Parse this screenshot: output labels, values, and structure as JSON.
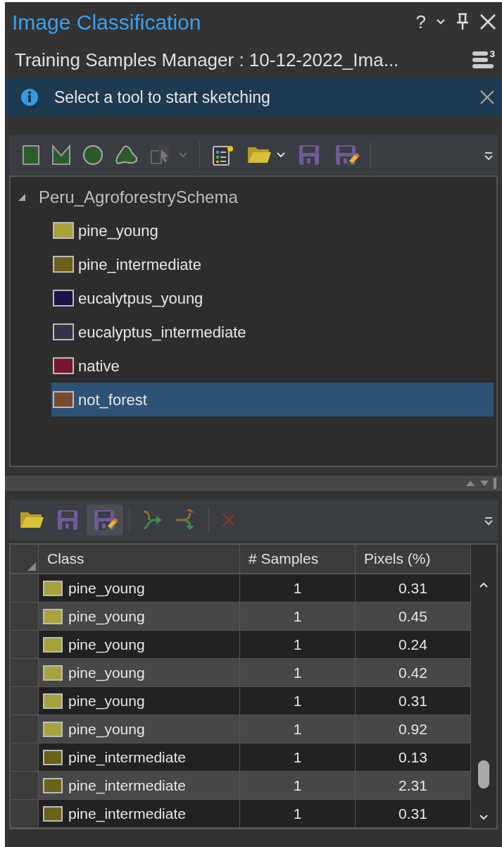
{
  "window": {
    "title": "Image Classification",
    "help": "?"
  },
  "subtitle": "Training Samples Manager : 10-12-2022_Ima...",
  "subtitle_badge": "3",
  "info_bar": {
    "message": "Select a tool to start sketching"
  },
  "schema": {
    "name": "Peru_AgroforestrySchema",
    "expanded": true,
    "children": [
      {
        "label": "pine_young",
        "color": "#a8a23c",
        "selected": false
      },
      {
        "label": "pine_intermediate",
        "color": "#6b6118",
        "selected": false
      },
      {
        "label": "eucalytpus_young",
        "color": "#1a1545",
        "selected": false
      },
      {
        "label": "eucalyptus_intermediate",
        "color": "#353449",
        "selected": false
      },
      {
        "label": "native",
        "color": "#7a1530",
        "selected": false
      },
      {
        "label": "not_forest",
        "color": "#7a4a2e",
        "selected": true
      }
    ]
  },
  "table": {
    "columns": [
      "Class",
      "# Samples",
      "Pixels (%)"
    ],
    "rows": [
      {
        "class": "pine_young",
        "color": "#a8a23c",
        "samples": "1",
        "pixels": "0.31"
      },
      {
        "class": "pine_young",
        "color": "#a8a23c",
        "samples": "1",
        "pixels": "0.45"
      },
      {
        "class": "pine_young",
        "color": "#a8a23c",
        "samples": "1",
        "pixels": "0.24"
      },
      {
        "class": "pine_young",
        "color": "#a8a23c",
        "samples": "1",
        "pixels": "0.42"
      },
      {
        "class": "pine_young",
        "color": "#a8a23c",
        "samples": "1",
        "pixels": "0.31"
      },
      {
        "class": "pine_young",
        "color": "#a8a23c",
        "samples": "1",
        "pixels": "0.92"
      },
      {
        "class": "pine_intermediate",
        "color": "#6b6118",
        "samples": "1",
        "pixels": "0.13"
      },
      {
        "class": "pine_intermediate",
        "color": "#6b6118",
        "samples": "1",
        "pixels": "2.31"
      },
      {
        "class": "pine_intermediate",
        "color": "#6b6118",
        "samples": "1",
        "pixels": "0.31"
      }
    ]
  }
}
